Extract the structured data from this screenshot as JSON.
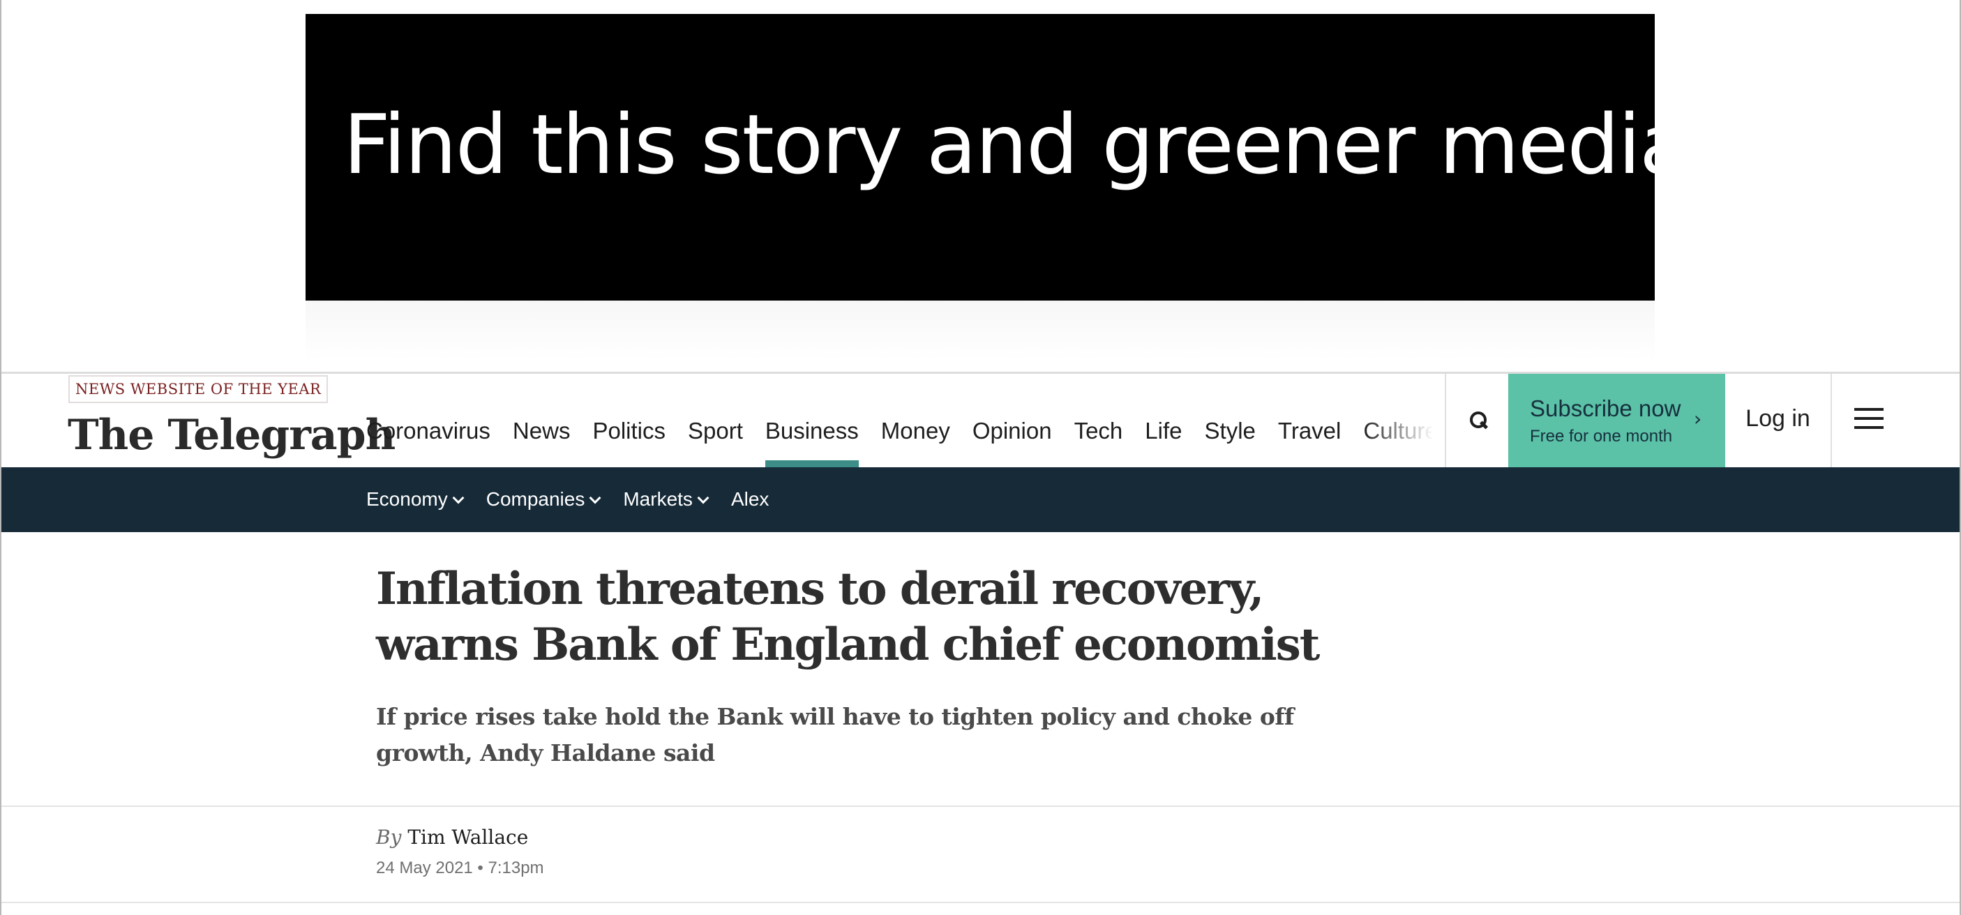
{
  "ad": {
    "text": "Find this story and greener media"
  },
  "masthead": {
    "award": "NEWS WEBSITE OF THE YEAR",
    "logo": "The Telegraph",
    "nav": [
      {
        "label": "Coronavirus",
        "active": false
      },
      {
        "label": "News",
        "active": false
      },
      {
        "label": "Politics",
        "active": false
      },
      {
        "label": "Sport",
        "active": false
      },
      {
        "label": "Business",
        "active": true
      },
      {
        "label": "Money",
        "active": false
      },
      {
        "label": "Opinion",
        "active": false
      },
      {
        "label": "Tech",
        "active": false
      },
      {
        "label": "Life",
        "active": false
      },
      {
        "label": "Style",
        "active": false
      },
      {
        "label": "Travel",
        "active": false
      },
      {
        "label": "Culture",
        "active": false
      }
    ],
    "search_icon": "search-icon",
    "subscribe": {
      "label": "Subscribe now",
      "sublabel": "Free for one month",
      "arrow": "›"
    },
    "login": "Log in",
    "menu_icon": "hamburger-menu-icon"
  },
  "subnav": {
    "items": [
      {
        "label": "Economy",
        "dropdown": true
      },
      {
        "label": "Companies",
        "dropdown": true
      },
      {
        "label": "Markets",
        "dropdown": true
      },
      {
        "label": "Alex",
        "dropdown": false
      }
    ]
  },
  "article": {
    "headline": "Inflation threatens to derail recovery, warns Bank of England chief economist",
    "standfirst": "If price rises take hold the Bank will have to tighten policy and choke off growth, Andy Haldane said",
    "byline_prefix": "By",
    "author": "Tim Wallace",
    "date": "24 May 2021 • 7:13pm"
  },
  "colors": {
    "accent": "#3c8c87",
    "subscribe_bg": "#5bc1a7",
    "subnav_bg": "#162a38",
    "ad_bg": "#000000",
    "award_text": "#7a1f1f"
  }
}
